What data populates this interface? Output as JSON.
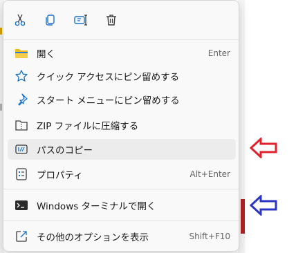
{
  "toolbar": {
    "icons": [
      "cut-icon",
      "copy-icon",
      "rename-icon",
      "delete-icon"
    ]
  },
  "menu": {
    "items": [
      {
        "label": "開く",
        "shortcut": "Enter",
        "icon": "folder-icon"
      },
      {
        "label": "クイック アクセスにピン留めする",
        "shortcut": "",
        "icon": "star-icon"
      },
      {
        "label": "スタート メニューにピン留めする",
        "shortcut": "",
        "icon": "pin-icon"
      },
      {
        "label": "ZIP ファイルに圧縮する",
        "shortcut": "",
        "icon": "zip-icon"
      },
      {
        "label": "パスのコピー",
        "shortcut": "",
        "icon": "copy-path-icon"
      },
      {
        "label": "プロパティ",
        "shortcut": "Alt+Enter",
        "icon": "properties-icon"
      },
      {
        "label": "Windows ターミナルで開く",
        "shortcut": "",
        "icon": "terminal-icon"
      },
      {
        "label": "その他のオプションを表示",
        "shortcut": "Shift+F10",
        "icon": "open-external-icon"
      }
    ]
  },
  "annotations": {
    "red_arrow_color": "#e0202a",
    "blue_arrow_color": "#2a35c4"
  },
  "colors": {
    "accent": "#1a73c7",
    "hover_bg": "#ececec"
  }
}
